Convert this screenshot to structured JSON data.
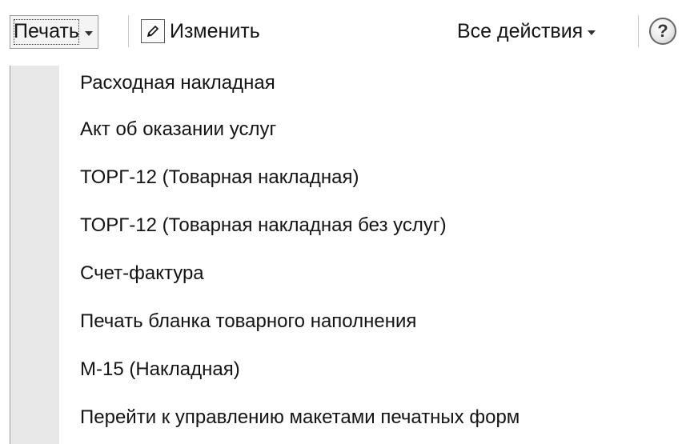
{
  "toolbar": {
    "print_label": "Печать",
    "edit_label": "Изменить",
    "actions_label": "Все действия",
    "help_label": "?"
  },
  "menu": {
    "items": [
      {
        "label": "Расходная накладная"
      },
      {
        "label": "Акт об оказании услуг"
      },
      {
        "label": "ТОРГ-12 (Товарная накладная)"
      },
      {
        "label": "ТОРГ-12 (Товарная накладная без услуг)"
      },
      {
        "label": "Счет-фактура"
      },
      {
        "label": "Печать бланка товарного наполнения"
      },
      {
        "label": "М-15 (Накладная)"
      },
      {
        "label": "Перейти к управлению макетами печатных форм"
      }
    ]
  },
  "icons": {
    "edit": "pencil-icon",
    "print_dropdown": "chevron-down-icon",
    "actions_dropdown": "chevron-down-icon",
    "help": "help-icon"
  }
}
